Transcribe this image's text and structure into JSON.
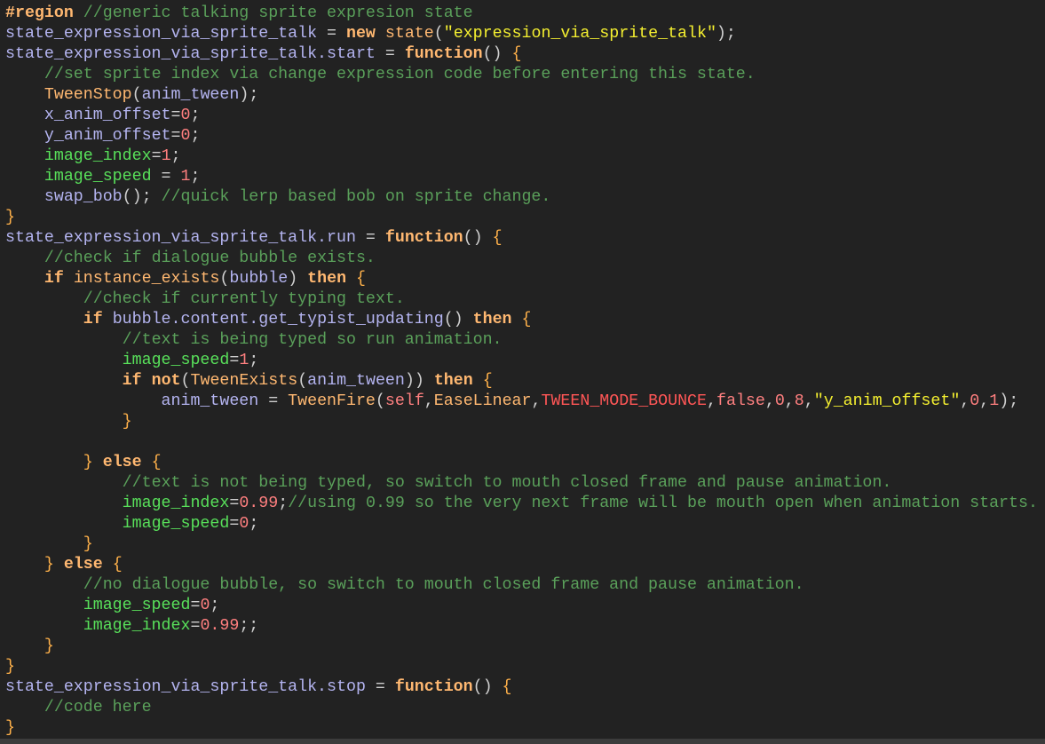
{
  "editor": {
    "lines": [
      [
        [
          "kw",
          "#region"
        ],
        [
          "ws",
          " "
        ],
        [
          "cm",
          "//generic talking sprite expresion state"
        ]
      ],
      [
        [
          "id",
          "state_expression_via_sprite_talk"
        ],
        [
          "p",
          " = "
        ],
        [
          "kw",
          "new"
        ],
        [
          "ws",
          " "
        ],
        [
          "fn",
          "state"
        ],
        [
          "p",
          "("
        ],
        [
          "str",
          "\"expression_via_sprite_talk\""
        ],
        [
          "p",
          ");"
        ]
      ],
      [
        [
          "id",
          "state_expression_via_sprite_talk.start"
        ],
        [
          "p",
          " = "
        ],
        [
          "kw",
          "function"
        ],
        [
          "p",
          "() "
        ],
        [
          "br",
          "{"
        ]
      ],
      [
        [
          "ws",
          "    "
        ],
        [
          "cm",
          "//set sprite index via change expression code before entering this state."
        ]
      ],
      [
        [
          "ws",
          "    "
        ],
        [
          "fn",
          "TweenStop"
        ],
        [
          "p",
          "("
        ],
        [
          "id",
          "anim_tween"
        ],
        [
          "p",
          ");"
        ]
      ],
      [
        [
          "ws",
          "    "
        ],
        [
          "id",
          "x_anim_offset"
        ],
        [
          "p",
          "="
        ],
        [
          "num",
          "0"
        ],
        [
          "p",
          ";"
        ]
      ],
      [
        [
          "ws",
          "    "
        ],
        [
          "id",
          "y_anim_offset"
        ],
        [
          "p",
          "="
        ],
        [
          "num",
          "0"
        ],
        [
          "p",
          ";"
        ]
      ],
      [
        [
          "ws",
          "    "
        ],
        [
          "bi",
          "image_index"
        ],
        [
          "p",
          "="
        ],
        [
          "num",
          "1"
        ],
        [
          "p",
          ";"
        ]
      ],
      [
        [
          "ws",
          "    "
        ],
        [
          "bi",
          "image_speed"
        ],
        [
          "p",
          " = "
        ],
        [
          "num",
          "1"
        ],
        [
          "p",
          ";"
        ]
      ],
      [
        [
          "ws",
          "    "
        ],
        [
          "id",
          "swap_bob"
        ],
        [
          "p",
          "(); "
        ],
        [
          "cm",
          "//quick lerp based bob on sprite change."
        ]
      ],
      [
        [
          "br",
          "}"
        ]
      ],
      [
        [
          "id",
          "state_expression_via_sprite_talk.run"
        ],
        [
          "p",
          " = "
        ],
        [
          "kw",
          "function"
        ],
        [
          "p",
          "() "
        ],
        [
          "br",
          "{"
        ]
      ],
      [
        [
          "ws",
          "    "
        ],
        [
          "cm",
          "//check if dialogue bubble exists."
        ]
      ],
      [
        [
          "ws",
          "    "
        ],
        [
          "kw",
          "if"
        ],
        [
          "ws",
          " "
        ],
        [
          "fn",
          "instance_exists"
        ],
        [
          "p",
          "("
        ],
        [
          "id",
          "bubble"
        ],
        [
          "p",
          ") "
        ],
        [
          "kw",
          "then"
        ],
        [
          "ws",
          " "
        ],
        [
          "br",
          "{"
        ]
      ],
      [
        [
          "ws",
          "        "
        ],
        [
          "cm",
          "//check if currently typing text."
        ]
      ],
      [
        [
          "ws",
          "        "
        ],
        [
          "kw",
          "if"
        ],
        [
          "ws",
          " "
        ],
        [
          "id",
          "bubble.content.get_typist_updating"
        ],
        [
          "p",
          "() "
        ],
        [
          "kw",
          "then"
        ],
        [
          "ws",
          " "
        ],
        [
          "br",
          "{"
        ]
      ],
      [
        [
          "ws",
          "            "
        ],
        [
          "cm",
          "//text is being typed so run animation."
        ]
      ],
      [
        [
          "ws",
          "            "
        ],
        [
          "bi",
          "image_speed"
        ],
        [
          "p",
          "="
        ],
        [
          "num",
          "1"
        ],
        [
          "p",
          ";"
        ]
      ],
      [
        [
          "ws",
          "            "
        ],
        [
          "kw",
          "if"
        ],
        [
          "ws",
          " "
        ],
        [
          "kw",
          "not"
        ],
        [
          "p",
          "("
        ],
        [
          "fn",
          "TweenExists"
        ],
        [
          "p",
          "("
        ],
        [
          "id",
          "anim_tween"
        ],
        [
          "p",
          "))"
        ],
        [
          "ws",
          " "
        ],
        [
          "kw",
          "then"
        ],
        [
          "ws",
          " "
        ],
        [
          "br",
          "{"
        ]
      ],
      [
        [
          "ws",
          "                "
        ],
        [
          "id",
          "anim_tween"
        ],
        [
          "p",
          " = "
        ],
        [
          "fn",
          "TweenFire"
        ],
        [
          "p",
          "("
        ],
        [
          "lit",
          "self"
        ],
        [
          "p",
          ","
        ],
        [
          "fn",
          "EaseLinear"
        ],
        [
          "p",
          ","
        ],
        [
          "con",
          "TWEEN_MODE_BOUNCE"
        ],
        [
          "p",
          ","
        ],
        [
          "lit",
          "false"
        ],
        [
          "p",
          ","
        ],
        [
          "num",
          "0"
        ],
        [
          "p",
          ","
        ],
        [
          "num",
          "8"
        ],
        [
          "p",
          ","
        ],
        [
          "str",
          "\"y_anim_offset\""
        ],
        [
          "p",
          ","
        ],
        [
          "num",
          "0"
        ],
        [
          "p",
          ","
        ],
        [
          "num",
          "1"
        ],
        [
          "p",
          ");"
        ]
      ],
      [
        [
          "ws",
          "            "
        ],
        [
          "br",
          "}"
        ]
      ],
      [],
      [
        [
          "ws",
          "        "
        ],
        [
          "br",
          "}"
        ],
        [
          "ws",
          " "
        ],
        [
          "kw",
          "else"
        ],
        [
          "ws",
          " "
        ],
        [
          "br",
          "{"
        ]
      ],
      [
        [
          "ws",
          "            "
        ],
        [
          "cm",
          "//text is not being typed, so switch to mouth closed frame and pause animation."
        ]
      ],
      [
        [
          "ws",
          "            "
        ],
        [
          "bi",
          "image_index"
        ],
        [
          "p",
          "="
        ],
        [
          "num",
          "0.99"
        ],
        [
          "p",
          ";"
        ],
        [
          "cm",
          "//using 0.99 so the very next frame will be mouth open when animation starts."
        ]
      ],
      [
        [
          "ws",
          "            "
        ],
        [
          "bi",
          "image_speed"
        ],
        [
          "p",
          "="
        ],
        [
          "num",
          "0"
        ],
        [
          "p",
          ";"
        ]
      ],
      [
        [
          "ws",
          "        "
        ],
        [
          "br",
          "}"
        ]
      ],
      [
        [
          "ws",
          "    "
        ],
        [
          "br",
          "}"
        ],
        [
          "ws",
          " "
        ],
        [
          "kw",
          "else"
        ],
        [
          "ws",
          " "
        ],
        [
          "br",
          "{"
        ]
      ],
      [
        [
          "ws",
          "        "
        ],
        [
          "cm",
          "//no dialogue bubble, so switch to mouth closed frame and pause animation."
        ]
      ],
      [
        [
          "ws",
          "        "
        ],
        [
          "bi",
          "image_speed"
        ],
        [
          "p",
          "="
        ],
        [
          "num",
          "0"
        ],
        [
          "p",
          ";"
        ]
      ],
      [
        [
          "ws",
          "        "
        ],
        [
          "bi",
          "image_index"
        ],
        [
          "p",
          "="
        ],
        [
          "num",
          "0.99"
        ],
        [
          "p",
          ";;"
        ]
      ],
      [
        [
          "ws",
          "    "
        ],
        [
          "br",
          "}"
        ]
      ],
      [
        [
          "br",
          "}"
        ]
      ],
      [
        [
          "id",
          "state_expression_via_sprite_talk.stop"
        ],
        [
          "p",
          " = "
        ],
        [
          "kw",
          "function"
        ],
        [
          "p",
          "() "
        ],
        [
          "br",
          "{"
        ]
      ],
      [
        [
          "ws",
          "    "
        ],
        [
          "cm",
          "//code here"
        ]
      ],
      [
        [
          "br",
          "}"
        ]
      ]
    ]
  }
}
